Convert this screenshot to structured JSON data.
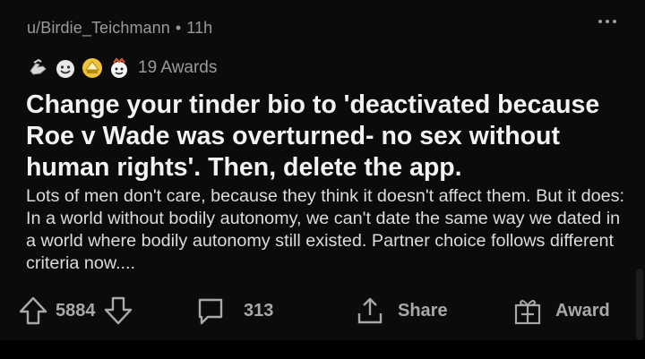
{
  "post": {
    "author": "u/Birdie_Teichmann",
    "separator": "•",
    "age": "11h",
    "awards": {
      "icons": [
        "silver-hands-award-icon",
        "smile-award-icon",
        "gold-ship-award-icon",
        "face-award-icon"
      ],
      "count_label": "19 Awards"
    },
    "title": "Change your tinder bio to 'deactivated because Roe v Wade was overturned- no sex without human rights'. Then, delete the app.",
    "body": "Lots of men don't care, because they think it doesn't affect them. But it does: In a world without bodily autonomy, we can't date the same way we dated in a world where bodily autonomy still existed. Partner choice follows different criteria now...."
  },
  "actions": {
    "score": "5884",
    "comments": "313",
    "share_label": "Share",
    "award_label": "Award"
  },
  "colors": {
    "background": "#0b0b0b",
    "title": "#f2f2f2",
    "meta": "#9a9a9a",
    "action": "#a8a8a8"
  }
}
